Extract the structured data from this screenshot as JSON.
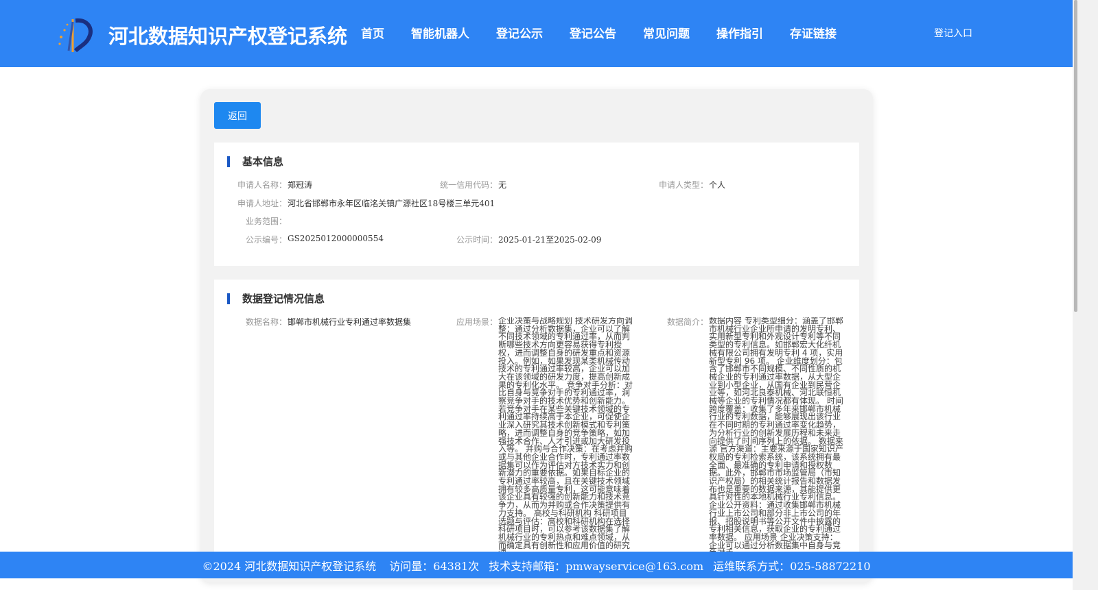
{
  "header": {
    "site_title": "河北数据知识产权登记系统",
    "nav": [
      "首页",
      "智能机器人",
      "登记公示",
      "登记公告",
      "常见问题",
      "操作指引",
      "存证链接"
    ],
    "login": "登记入口",
    "accent_color": "#2e84f4"
  },
  "back_button": "返回",
  "basic_info": {
    "title": "基本信息",
    "applicant_name_label": "申请人名称：",
    "applicant_name": "郑冠涛",
    "credit_code_label": "统一信用代码：",
    "credit_code": "无",
    "applicant_type_label": "申请人类型：",
    "applicant_type": "个人",
    "address_label": "申请人地址：",
    "address": "河北省邯郸市永年区临洺关镇广源社区18号楼三单元401",
    "business_scope_label": "业务范围：",
    "business_scope": "",
    "notice_no_label": "公示编号：",
    "notice_no": "GS2025012000000554",
    "notice_time_label": "公示时间：",
    "notice_time": "2025-01-21至2025-02-09"
  },
  "data_info": {
    "title": "数据登记情况信息",
    "data_name_label": "数据名称：",
    "data_name": "邯郸市机械行业专利通过率数据集",
    "scenario_label": "应用场景：",
    "scenario": "企业决策与战略规划 技术研发方向调整：通过分析数据集，企业可以了解不同技术领域的专利通过率，从而判断哪些技术方向更容易获得专利授权，进而调整自身的研发重点和资源投入。例如，如果发现某类机械传动技术的专利通过率较高，企业可以加大在该领域的研发力度，提高创新成果的专利化水平。 竞争对手分析：对比自身与竞争对手的专利通过率，洞察竞争对手的技术优势和创新能力。若竞争对手在某些关键技术领域的专利通过率持续高于本企业，可促使企业深入研究其技术创新模式和专利策略，进而调整自身的竞争策略，如加强技术合作、人才引进或加大研发投入等。 并购与合作决策：在考虑并购或与其他企业合作时，专利通过率数据集可以作为评估对方技术实力和创新潜力的重要依据。如果目标企业的专利通过率较高，且在关键技术领域拥有较多高质量专利，这可能意味着该企业具有较强的创新能力和技术竞争力，从而为并购或合作决策提供有力支持。 高校与科研机构 科研项目选题与评估：高校和科研机构在选择科研项目时，可以参考该数据集了解机械行业的专利热点和难点领域，从而确定具有创新性和应用价值的研究课",
    "intro_label": "数据简介：",
    "intro": "数据内容 专利类型细分：涵盖了邯郸市机械行业企业所申请的发明专利、实用新型专利和外观设计专利等不同类型的专利信息。如邯郸宏大化纤机械有限公司拥有发明专利 4 项，实用新型专利 96 项。 企业维度划分：包含了邯郸市不同规模、不同性质的机械企业的专利通过率数据，从大型企业到小型企业，从国有企业到民营企业等，如河北良泰机械、河北联恒机械等企业的专利情况都有体现。 时间跨度覆盖：收集了多年来邯郸市机械行业的专利数据，能够展现出该行业在不同时期的专利通过率变化趋势，为分析行业的创新发展历程和未来走向提供了时间序列上的依据。 数据来源 官方渠道：主要来源于国家知识产权局的专利检索系统，该系统拥有最全面、最准确的专利申请和授权数据。此外，邯郸市市场监管局（市知识产权局）的相关统计报告和数据发布也是重要的数据来源，其能提供更具针对性的本地机械行业专利信息。 企业公开资料：通过收集邯郸市机械行业上市公司和部分非上市公司的年报、招股说明书等公开文件中披露的专利相关信息，获取企业的专利通过率数据。 应用场景 企业决策支持：企业可以通过分析数据集中自身与竞争对手"
  },
  "footer": {
    "copyright": "©2024 河北数据知识产权登记系统",
    "visits": "访问量：64381次",
    "email": "技术支持邮箱：pmwayservice@163.com",
    "phone": "运维联系方式：025-58872210"
  }
}
